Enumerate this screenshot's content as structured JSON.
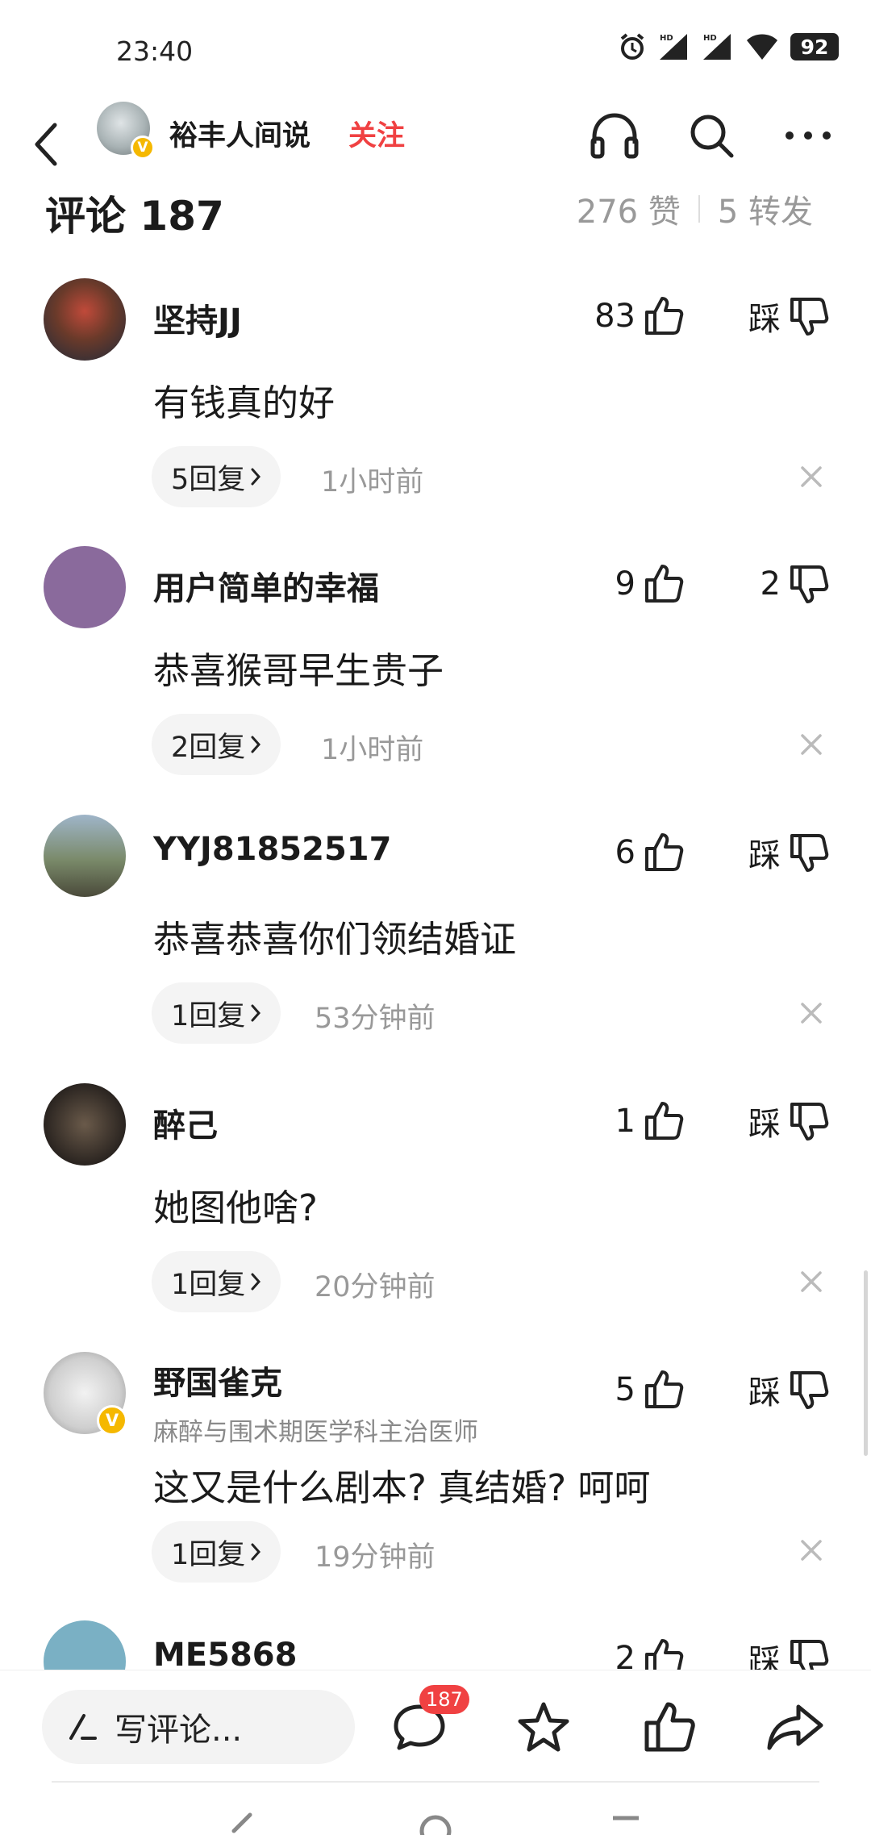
{
  "status_bar": {
    "time": "23:40",
    "battery": "92"
  },
  "header": {
    "author_name": "裕丰人间说",
    "follow_label": "关注",
    "verified_mark": "V"
  },
  "comments_header": {
    "title": "评论 187",
    "likes": "276 赞",
    "shares": "5 转发"
  },
  "comments": [
    {
      "name": "坚持JJ",
      "subtitle": "",
      "likes": "83",
      "dislike": "踩",
      "text": "有钱真的好",
      "replies": "5回复",
      "time": "1小时前",
      "verified": false
    },
    {
      "name": "用户简单的幸福",
      "subtitle": "",
      "likes": "9",
      "dislike": "2",
      "text": "恭喜猴哥早生贵子",
      "replies": "2回复",
      "time": "1小时前",
      "verified": false
    },
    {
      "name": "YYJ81852517",
      "subtitle": "",
      "likes": "6",
      "dislike": "踩",
      "text": "恭喜恭喜你们领结婚证",
      "replies": "1回复",
      "time": "53分钟前",
      "verified": false
    },
    {
      "name": "醉己",
      "subtitle": "",
      "likes": "1",
      "dislike": "踩",
      "text": "她图他啥?",
      "replies": "1回复",
      "time": "20分钟前",
      "verified": false
    },
    {
      "name": "野国雀克",
      "subtitle": "麻醉与围术期医学科主治医师",
      "likes": "5",
      "dislike": "踩",
      "text": "这又是什么剧本? 真结婚? 呵呵",
      "replies": "1回复",
      "time": "19分钟前",
      "verified": true
    },
    {
      "name": "ME5868",
      "subtitle": "",
      "likes": "2",
      "dislike": "踩",
      "text": "",
      "replies": "",
      "time": "",
      "verified": false
    }
  ],
  "bottom_bar": {
    "write_placeholder": "写评论...",
    "comment_count": "187"
  },
  "icons": [
    "back-icon",
    "headphones-icon",
    "search-icon",
    "more-icon",
    "thumbs-up-icon",
    "thumbs-down-icon",
    "close-icon",
    "chevron-right-icon",
    "pen-icon",
    "comment-icon",
    "star-icon",
    "share-icon",
    "alarm-icon",
    "signal-icon",
    "wifi-icon"
  ],
  "colors": {
    "accent": "#f04142",
    "verified": "#f5b800",
    "text": "#1b1b1b",
    "muted": "#999999"
  }
}
